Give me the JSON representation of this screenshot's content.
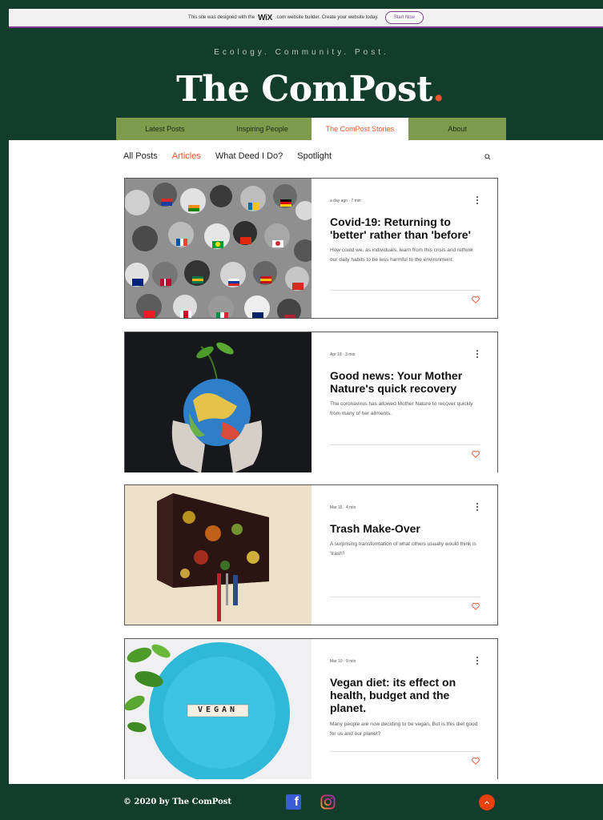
{
  "banner": {
    "text_before": "This site was designed with the",
    "logo": "WiX",
    "text_after": ".com website builder. Create your website today.",
    "button": "Start Now"
  },
  "header": {
    "tagline": "Ecology. Community. Post.",
    "title": "The ComPost",
    "title_dot": "."
  },
  "nav": {
    "items": [
      {
        "label": "Latest Posts"
      },
      {
        "label": "Inspiring People"
      },
      {
        "label": "The ComPost Stories"
      },
      {
        "label": "About"
      }
    ],
    "active_index": 2
  },
  "categories": {
    "items": [
      {
        "label": "All Posts"
      },
      {
        "label": "Articles"
      },
      {
        "label": "What Deed I Do?"
      },
      {
        "label": "Spotlight"
      }
    ],
    "active_index": 1,
    "search_icon": "search-icon"
  },
  "posts": [
    {
      "meta": "a day ago  ·  7 min",
      "title": "Covid-19: Returning to 'better' rather than 'before'",
      "excerpt": "How could we, as individuals, learn from this crisis and rethink our daily habits to be less harmful to the environment."
    },
    {
      "meta": "Apr 18  ·  3 min",
      "title": "Good news: Your Mother Nature's quick recovery",
      "excerpt": "The coronavirus has allowed Mother Nature to recover quickly from many of her ailments."
    },
    {
      "meta": "Mar 15  ·  4 min",
      "title": "Trash Make-Over",
      "excerpt": "A surprising transformation of what others usually would think is 'trash'!"
    },
    {
      "meta": "Mar 10  ·  9 min",
      "title": "Vegan diet: its effect on health, budget and the planet.",
      "excerpt": "Many people are now deciding to be vegan. But is this diet good for us and our planet?",
      "image_text": "VEGAN"
    }
  ],
  "footer": {
    "copyright": "© 2020 by The ComPost",
    "fb_letter": "f"
  },
  "colors": {
    "background": "#123c2b",
    "nav": "#7e9b4b",
    "accent": "#e8542c"
  }
}
